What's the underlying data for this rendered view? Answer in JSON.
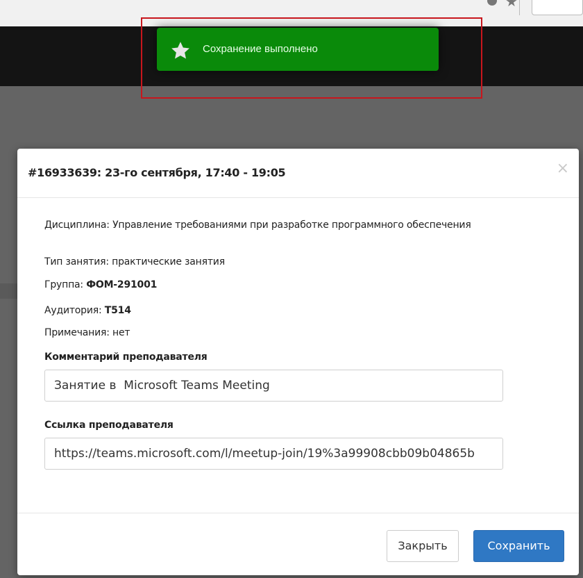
{
  "toast": {
    "icon": "star-icon",
    "message": "Сохранение выполнено",
    "color": "#0a8a0a"
  },
  "modal": {
    "title": "#16933639: 23-го сентября, 17:40 - 19:05",
    "close_symbol": "×",
    "discipline_label": "Дисциплина:",
    "discipline_value": "Управление требованиями при разработке программного обеспечения",
    "lesson_type_label": "Тип занятия:",
    "lesson_type_value": "практические занятия",
    "group_label": "Группа:",
    "group_value": "ФОМ-291001",
    "room_label": "Аудитория:",
    "room_value": "Т514",
    "notes_label": "Примечания:",
    "notes_value": "нет",
    "comment_label": "Комментарий преподавателя",
    "comment_value": "Занятие в  Microsoft Teams Meeting",
    "link_label": "Ссылка преподавателя",
    "link_value": "https://teams.microsoft.com/l/meetup-join/19%3a99908cbb09b04865b",
    "close_button": "Закрыть",
    "save_button": "Сохранить"
  },
  "colors": {
    "save_button": "#2f78c4",
    "highlight_border": "#c8161d"
  }
}
